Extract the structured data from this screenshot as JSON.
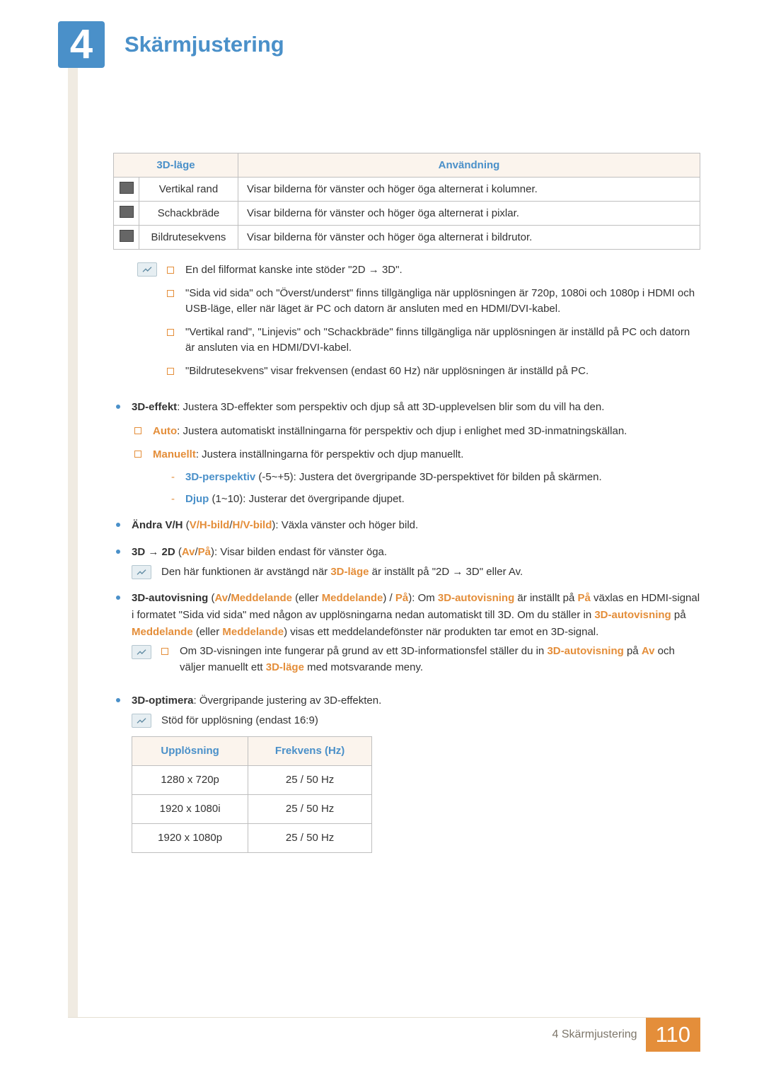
{
  "chapter_number": "4",
  "chapter_title": "Skärmjustering",
  "mode_table": {
    "headers": {
      "mode": "3D-läge",
      "usage": "Användning"
    },
    "rows": [
      {
        "mode": "Vertikal rand",
        "usage": "Visar bilderna för vänster och höger öga alternerat i kolumner."
      },
      {
        "mode": "Schackbräde",
        "usage": "Visar bilderna för vänster och höger öga alternerat i pixlar."
      },
      {
        "mode": "Bildrutesekvens",
        "usage": "Visar bilderna för vänster och höger öga alternerat i bildrutor."
      }
    ]
  },
  "notes1": [
    "En del filformat kanske inte stöder \"2D → 3D\".",
    "\"Sida vid sida\" och \"Överst/underst\" finns tillgängliga när upplösningen är 720p, 1080i och 1080p i HDMI och USB-läge, eller när läget är PC och datorn är ansluten med en HDMI/DVI-kabel.",
    "\"Vertikal rand\", \"Linjevis\" och \"Schackbräde\" finns tillgängliga när upplösningen är inställd på PC och datorn är ansluten via en HDMI/DVI-kabel.",
    "\"Bildrutesekvens\" visar frekvensen (endast 60 Hz) när upplösningen är inställd på PC."
  ],
  "b1": {
    "label": "3D-effekt",
    "rest": ": Justera 3D-effekter som perspektiv och djup så att 3D-upplevelsen blir som du vill ha den.",
    "sub": [
      {
        "label": "Auto",
        "rest": ": Justera automatiskt inställningarna för perspektiv och djup i enlighet med 3D-inmatningskällan."
      },
      {
        "label": "Manuellt",
        "rest": ": Justera inställningarna för perspektiv och djup manuellt."
      }
    ],
    "dashes": [
      {
        "label": "3D-perspektiv",
        "paren": " (-5~+5)",
        "rest": ": Justera det övergripande 3D-perspektivet för bilden på skärmen."
      },
      {
        "label": "Djup",
        "paren": " (1~10)",
        "rest": ": Justerar det övergripande djupet."
      }
    ]
  },
  "b2": {
    "label": "Ändra V/H",
    "paren_open": " (",
    "opt1": "V/H-bild",
    "sep": "/",
    "opt2": "H/V-bild",
    "paren_close": ")",
    "rest": ": Växla vänster och höger bild."
  },
  "b3": {
    "label": "3D → 2D",
    "paren_open": " (",
    "opt1": "Av",
    "sep": "/",
    "opt2": "På",
    "paren_close": ")",
    "rest": ": Visar bilden endast för vänster öga."
  },
  "note2_pre": "Den här funktionen är avstängd när ",
  "note2_mid": "3D-läge",
  "note2_post": " är inställt på \"2D → 3D\" eller Av.",
  "b4": {
    "label": "3D-autovisning",
    "paren_open": " (",
    "opt1": "Av",
    "sep1": "/",
    "opt2": "Meddelande",
    "or_open": " (eller ",
    "opt2b": "Meddelande",
    "or_close": ")",
    "sep2": " / ",
    "opt3": "På",
    "paren_close": "): Om ",
    "label2": "3D-autovisning",
    "mid1": " är inställt på ",
    "val_on": "På",
    "tail1": " växlas en HDMI-signal i formatet \"Sida vid sida\" med någon av upplösningarna nedan automatiskt till 3D. Om du ställer in ",
    "label3": "3D-autovisning",
    "tail2": " på ",
    "val_msg": "Meddelande",
    "tail3": " (eller ",
    "val_msg2": "Meddelande",
    "tail4": ") visas ett meddelandefönster när produkten tar emot en 3D-signal."
  },
  "note3_pre": "Om 3D-visningen inte fungerar på grund av ett 3D-informationsfel ställer du in ",
  "note3_a": "3D-autovisning",
  "note3_mid": " på ",
  "note3_b": "Av",
  "note3_mid2": " och väljer manuellt ett ",
  "note3_c": "3D-läge",
  "note3_post": " med motsvarande meny.",
  "b5": {
    "label": "3D-optimera",
    "rest": ": Övergripande justering av 3D-effekten."
  },
  "note4": "Stöd för upplösning (endast 16:9)",
  "res_table": {
    "headers": {
      "res": "Upplösning",
      "freq": "Frekvens (Hz)"
    },
    "rows": [
      {
        "res": "1280 x 720p",
        "freq": "25 / 50 Hz"
      },
      {
        "res": "1920 x 1080i",
        "freq": "25 / 50 Hz"
      },
      {
        "res": "1920 x 1080p",
        "freq": "25 / 50 Hz"
      }
    ]
  },
  "footer": {
    "text": "4 Skärmjustering",
    "page": "110"
  }
}
